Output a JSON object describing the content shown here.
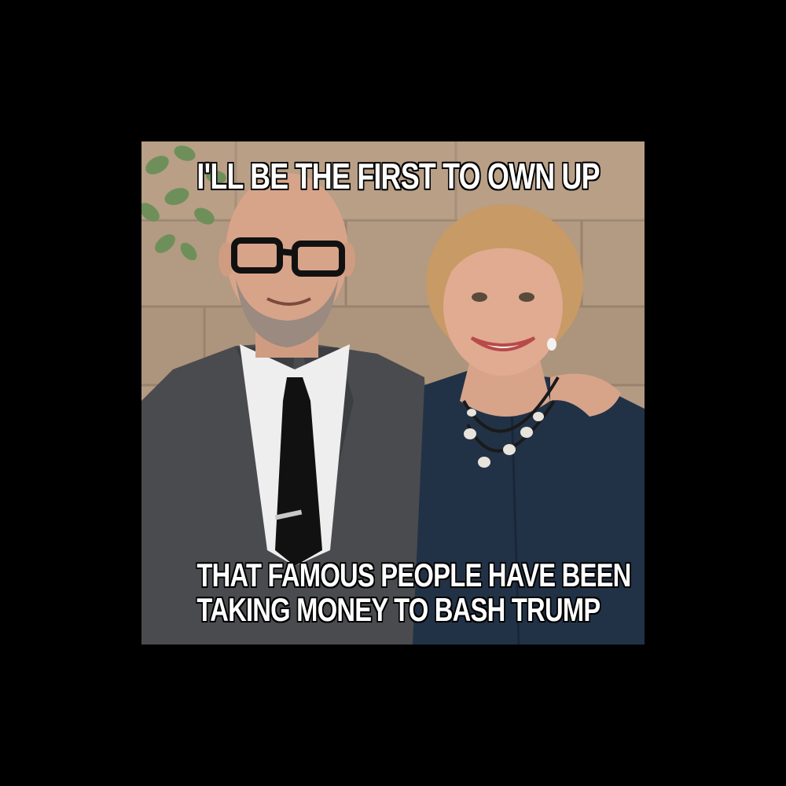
{
  "meme": {
    "top_text": "I'LL BE THE FIRST TO OWN UP",
    "bottom_lines": [
      "THAT FAMOUS PEOPLE HAVE BEEN",
      "TAKING MONEY TO BASH TRUMP"
    ]
  },
  "colors": {
    "background": "#000000",
    "caption_fill": "#ffffff",
    "caption_outline": "#000000",
    "wall": "#b39a82",
    "suit": "#4a4b4f",
    "dress": "#223246",
    "shirt": "#eeeeee",
    "skin": "#d7a48a",
    "hair": "#c79a66"
  }
}
